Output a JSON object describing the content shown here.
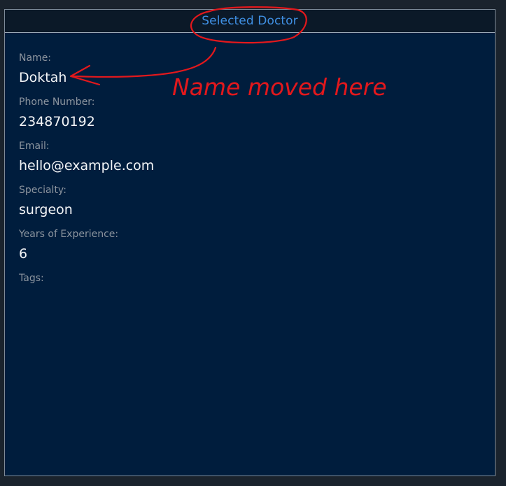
{
  "panel": {
    "title": "Selected Doctor"
  },
  "fields": [
    {
      "label": "Name:",
      "value": "Doktah"
    },
    {
      "label": "Phone Number:",
      "value": "234870192"
    },
    {
      "label": "Email:",
      "value": "hello@example.com"
    },
    {
      "label": "Specialty:",
      "value": "surgeon"
    },
    {
      "label": "Years of Experience:",
      "value": "6"
    },
    {
      "label": "Tags:",
      "value": ""
    }
  ],
  "annotation": {
    "note": "Name moved here",
    "ink_color": "#e3181c"
  },
  "colors": {
    "title": "#3f8fe2",
    "panel_bg": "#001d3d",
    "label": "#8b949e",
    "value": "#f3f5f7"
  }
}
